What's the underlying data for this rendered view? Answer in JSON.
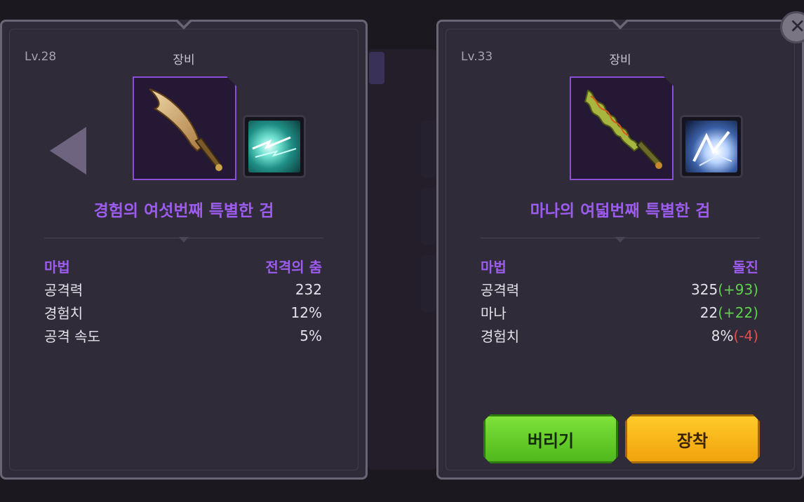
{
  "left_panel": {
    "level": "Lv.28",
    "title": "장비",
    "item_name": "경험의 여섯번째 특별한 검",
    "stats": [
      {
        "label": "마법",
        "value": "전격의 춤",
        "delta": ""
      },
      {
        "label": "공격력",
        "value": "232",
        "delta": ""
      },
      {
        "label": "경험치",
        "value": "12%",
        "delta": ""
      },
      {
        "label": "공격 속도",
        "value": "5%",
        "delta": ""
      }
    ]
  },
  "right_panel": {
    "level": "Lv.33",
    "title": "장비",
    "item_name": "마나의 여덟번째 특별한 검",
    "stats": [
      {
        "label": "마법",
        "value": "돌진",
        "delta": ""
      },
      {
        "label": "공격력",
        "value": "325",
        "delta": "(+93)"
      },
      {
        "label": "마나",
        "value": "22",
        "delta": "(+22)"
      },
      {
        "label": "경험치",
        "value": "8%",
        "delta": "(-4)"
      }
    ],
    "discard_label": "버리기",
    "equip_label": "장착"
  },
  "colors": {
    "item_name": "#9d5cf0",
    "positive": "#5fd24b",
    "negative": "#e05050",
    "discard_button": "#5fcc28",
    "equip_button": "#f5b418"
  },
  "icons": {
    "prev": "arrow-left-icon",
    "close": "close-icon",
    "left_item": "curved-sword-icon",
    "left_skill": "lightning-dance-skill-icon",
    "right_item": "serpent-sword-icon",
    "right_skill": "dash-skill-icon"
  }
}
